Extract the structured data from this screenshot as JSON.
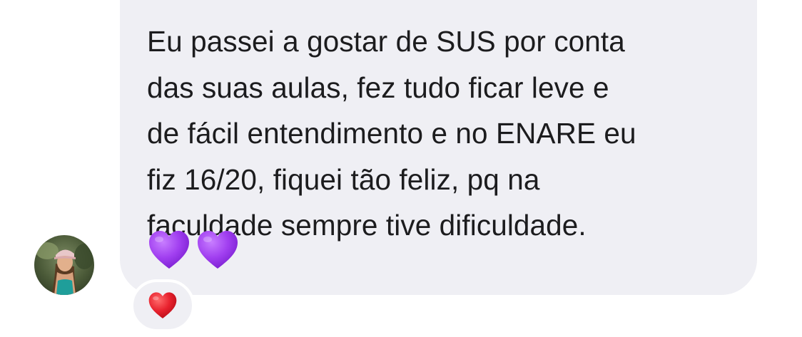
{
  "message": {
    "lines": [
      "Eu passei a gostar de SUS por conta",
      "das suas aulas, fez tudo ficar leve e",
      "de fácil entendimento e no ENARE eu",
      "fiz 16/20, fiquei tão feliz, pq na",
      "faculdade sempre tive dificuldade."
    ],
    "emojis": [
      "purple-heart-icon",
      "purple-heart-icon"
    ]
  },
  "reaction": {
    "emoji": "red-heart-icon"
  },
  "colors": {
    "bubble_bg": "#efeff4",
    "text": "#1c1c1e",
    "purple_heart": "#a13ff0",
    "red_heart": "#e8222e"
  }
}
